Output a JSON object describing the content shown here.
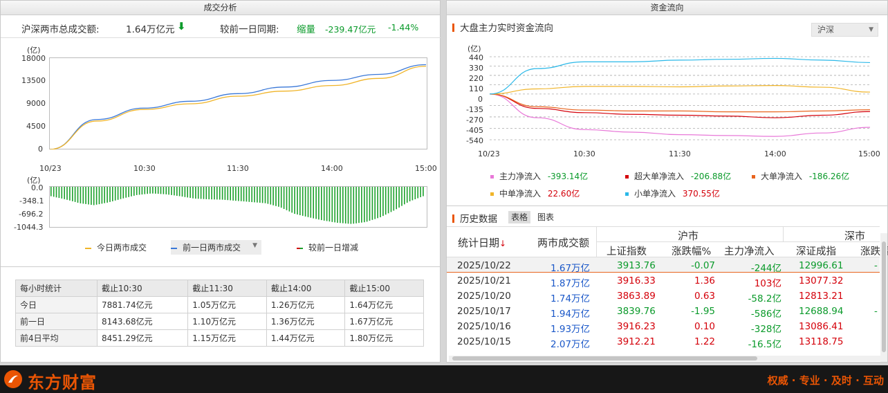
{
  "left": {
    "title": "成交分析",
    "summary": {
      "total_label": "沪深两市总成交额:",
      "total_value": "1.64万亿元",
      "compare_label": "较前一日同期:",
      "change_tag": "缩量",
      "change_amount": "-239.47亿元",
      "change_pct": "-1.44%"
    },
    "turnover_chart": {
      "unit": "(亿)",
      "y_ticks": [
        "18000",
        "13500",
        "9000",
        "4500",
        "0"
      ],
      "x_ticks": [
        "10/23",
        "10:30",
        "11:30",
        "14:00",
        "15:00"
      ]
    },
    "diff_chart": {
      "unit": "(亿)",
      "y_ticks": [
        "0.0",
        "-348.1",
        "-696.2",
        "-1044.3"
      ]
    },
    "legend": {
      "today": "今日两市成交",
      "prev": "前一日两市成交",
      "diff": "较前一日增减"
    },
    "hourly_table": {
      "headers": [
        "每小时统计",
        "截止10:30",
        "截止11:30",
        "截止14:00",
        "截止15:00"
      ],
      "rows": [
        [
          "今日",
          "7881.74亿元",
          "1.05万亿元",
          "1.26万亿元",
          "1.64万亿元"
        ],
        [
          "前一日",
          "8143.68亿元",
          "1.10万亿元",
          "1.36万亿元",
          "1.67万亿元"
        ],
        [
          "前4日平均",
          "8451.29亿元",
          "1.15万亿元",
          "1.44万亿元",
          "1.80万亿元"
        ]
      ]
    }
  },
  "right": {
    "title": "资金流向",
    "flow_section_title": "大盘主力实时资金流向",
    "market_select": "沪深",
    "flow_chart": {
      "unit": "(亿)",
      "y_ticks": [
        "440",
        "330",
        "220",
        "110",
        "0",
        "-135",
        "-270",
        "-405",
        "-540"
      ],
      "x_ticks": [
        "10/23",
        "10:30",
        "11:30",
        "14:00",
        "15:00"
      ]
    },
    "flow_legend": [
      {
        "label": "主力净流入",
        "value": "-393.14亿",
        "color": "#e878d8",
        "value_class": "green"
      },
      {
        "label": "超大单净流入",
        "value": "-206.88亿",
        "color": "#d4000a",
        "value_class": "green"
      },
      {
        "label": "大单净流入",
        "value": "-186.26亿",
        "color": "#e8641e",
        "value_class": "green"
      },
      {
        "label": "中单净流入",
        "value": "22.60亿",
        "color": "#f0b428",
        "value_class": "red"
      },
      {
        "label": "小单净流入",
        "value": "370.55亿",
        "color": "#2ab8e8",
        "value_class": "red"
      }
    ],
    "history": {
      "title": "历史数据",
      "tab_table": "表格",
      "tab_chart": "图表",
      "group_sh": "沪市",
      "group_sz": "深市",
      "col_date": "统计日期",
      "col_turnover": "两市成交额",
      "sub_headers": [
        "上证指数",
        "涨跌幅%",
        "主力净流入",
        "深证成指",
        "涨跌幅"
      ],
      "rows": [
        {
          "date": "2025/10/22",
          "turnover": "1.67万亿",
          "sh_index": "3913.76",
          "sh_change": "-0.07",
          "sh_flow": "-244亿",
          "sz_index": "12996.61",
          "sz_change": "-",
          "dir": "down"
        },
        {
          "date": "2025/10/21",
          "turnover": "1.87万亿",
          "sh_index": "3916.33",
          "sh_change": "1.36",
          "sh_flow": "103亿",
          "sz_index": "13077.32",
          "sz_change": "",
          "dir": "up"
        },
        {
          "date": "2025/10/20",
          "turnover": "1.74万亿",
          "sh_index": "3863.89",
          "sh_change": "0.63",
          "sh_flow": "-58.2亿",
          "sz_index": "12813.21",
          "sz_change": "",
          "dir": "up"
        },
        {
          "date": "2025/10/17",
          "turnover": "1.94万亿",
          "sh_index": "3839.76",
          "sh_change": "-1.95",
          "sh_flow": "-586亿",
          "sz_index": "12688.94",
          "sz_change": "-",
          "dir": "down"
        },
        {
          "date": "2025/10/16",
          "turnover": "1.93万亿",
          "sh_index": "3916.23",
          "sh_change": "0.10",
          "sh_flow": "-328亿",
          "sz_index": "13086.41",
          "sz_change": "",
          "dir": "up"
        },
        {
          "date": "2025/10/15",
          "turnover": "2.07万亿",
          "sh_index": "3912.21",
          "sh_change": "1.22",
          "sh_flow": "-16.5亿",
          "sz_index": "13118.75",
          "sz_change": "",
          "dir": "up"
        }
      ]
    }
  },
  "footer": {
    "brand": "东方财富",
    "slogan": "权威 · 专业 · 及时 · 互动"
  },
  "colors": {
    "today_line": "#f0b428",
    "prev_line": "#3a78d8",
    "diff_bar": "#1aa02a",
    "brand": "#ea5504"
  },
  "chart_data": [
    {
      "type": "line",
      "ylabel": "(亿)",
      "ylim": [
        0,
        18000
      ],
      "x": [
        "09:30",
        "10:00",
        "10:30",
        "11:00",
        "11:30",
        "13:30",
        "14:00",
        "14:30",
        "15:00"
      ],
      "series": [
        {
          "name": "今日两市成交",
          "values": [
            0,
            5600,
            7882,
            9000,
            10500,
            11500,
            12600,
            14000,
            16400
          ]
        },
        {
          "name": "前一日两市成交",
          "values": [
            0,
            5900,
            8144,
            9500,
            11000,
            12300,
            13600,
            14800,
            16700
          ]
        }
      ]
    },
    {
      "type": "bar",
      "ylabel": "(亿)",
      "ylim": [
        -1044.3,
        0
      ],
      "name": "较前一日增减",
      "values": [
        -240,
        -320,
        -420,
        -470,
        -400,
        -300,
        -210,
        -170,
        -190,
        -240,
        -300,
        -320,
        -330,
        -360,
        -390,
        -420,
        -520,
        -690,
        -780,
        -860,
        -920,
        -950,
        -900,
        -780,
        -600,
        -380,
        -240
      ]
    },
    {
      "type": "line",
      "ylabel": "(亿)",
      "ylim": [
        -540,
        440
      ],
      "x": [
        "09:30",
        "10:00",
        "10:30",
        "11:00",
        "11:30",
        "13:30",
        "14:00",
        "14:30",
        "15:00"
      ],
      "series": [
        {
          "name": "主力净流入",
          "values": [
            0,
            -280,
            -420,
            -450,
            -480,
            -490,
            -500,
            -460,
            -393
          ]
        },
        {
          "name": "超大单净流入",
          "values": [
            0,
            -170,
            -220,
            -240,
            -250,
            -260,
            -280,
            -250,
            -207
          ]
        },
        {
          "name": "大单净流入",
          "values": [
            0,
            -150,
            -190,
            -200,
            -200,
            -210,
            -210,
            -200,
            -186
          ]
        },
        {
          "name": "中单净流入",
          "values": [
            0,
            60,
            90,
            90,
            85,
            95,
            100,
            80,
            23
          ]
        },
        {
          "name": "小单净流入",
          "values": [
            0,
            300,
            380,
            380,
            400,
            410,
            420,
            400,
            371
          ]
        }
      ]
    }
  ]
}
